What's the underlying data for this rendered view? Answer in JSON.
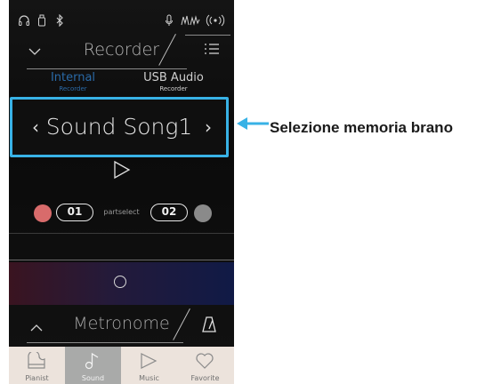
{
  "header": {
    "title": "Recorder"
  },
  "tabs": [
    {
      "label": "Internal",
      "sublabel": "Recorder",
      "active": true
    },
    {
      "label": "USB Audio",
      "sublabel": "Recorder",
      "active": false
    }
  ],
  "song_selector": {
    "name": "Sound Song1",
    "prev_glyph": "‹",
    "next_glyph": "›"
  },
  "parts": {
    "part1": "01",
    "part2": "02",
    "label": "partselect",
    "part1_color": "#d86b6b",
    "part2_color": "#8a8a8a"
  },
  "metronome": {
    "title": "Metronome"
  },
  "nav": [
    {
      "label": "Pianist",
      "icon": "piano-icon",
      "active": false
    },
    {
      "label": "Sound",
      "icon": "music-note-icon",
      "active": true
    },
    {
      "label": "Music",
      "icon": "play-icon",
      "active": false
    },
    {
      "label": "Favorite",
      "icon": "heart-icon",
      "active": false
    }
  ],
  "annotation": {
    "text": "Selezione memoria brano"
  },
  "colors": {
    "highlight": "#38b2e6",
    "active_tab": "#2a6aa8"
  }
}
